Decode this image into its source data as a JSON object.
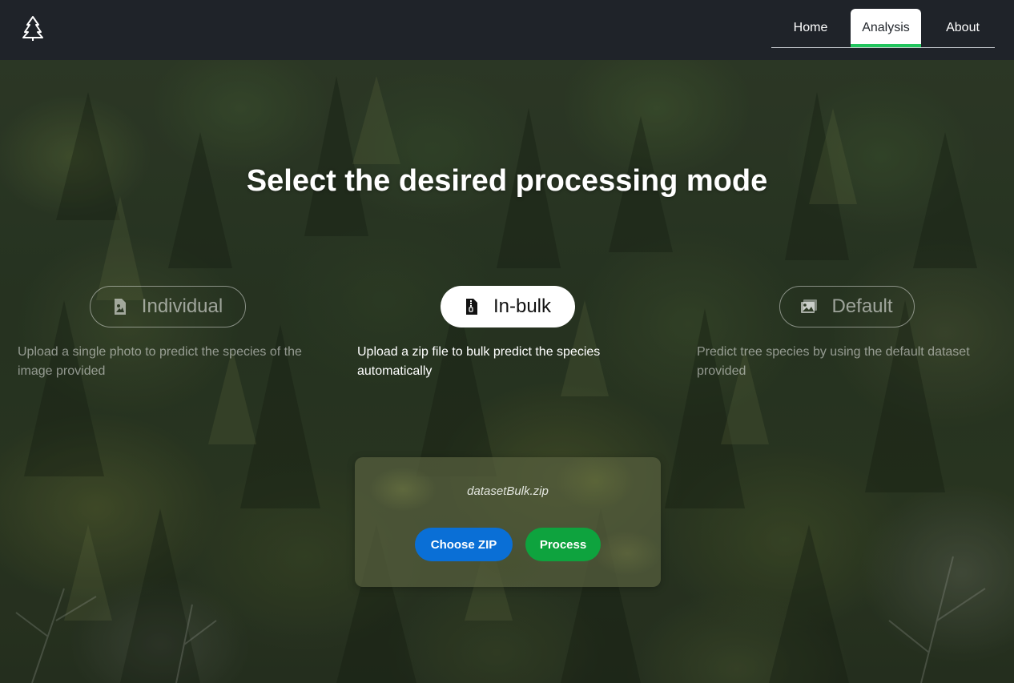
{
  "nav": {
    "links": [
      {
        "label": "Home",
        "active": false
      },
      {
        "label": "Analysis",
        "active": true
      },
      {
        "label": "About",
        "active": false
      }
    ],
    "logo_icon": "pine-tree-icon",
    "active_indicator_color": "#22c55e"
  },
  "main": {
    "title": "Select the desired processing mode",
    "modes": [
      {
        "label": "Individual",
        "icon": "image-file-icon",
        "description": "Upload a single photo to predict the species of the image provided",
        "selected": false
      },
      {
        "label": "In-bulk",
        "icon": "zip-file-icon",
        "description": "Upload a zip file to bulk predict the species automatically",
        "selected": true
      },
      {
        "label": "Default",
        "icon": "images-icon",
        "description": "Predict tree species by using the default dataset provided",
        "selected": false
      }
    ]
  },
  "upload": {
    "file_name": "datasetBulk.zip",
    "choose_label": "Choose ZIP",
    "process_label": "Process",
    "choose_color": "#0a6fd6",
    "process_color": "#0ea33e"
  }
}
